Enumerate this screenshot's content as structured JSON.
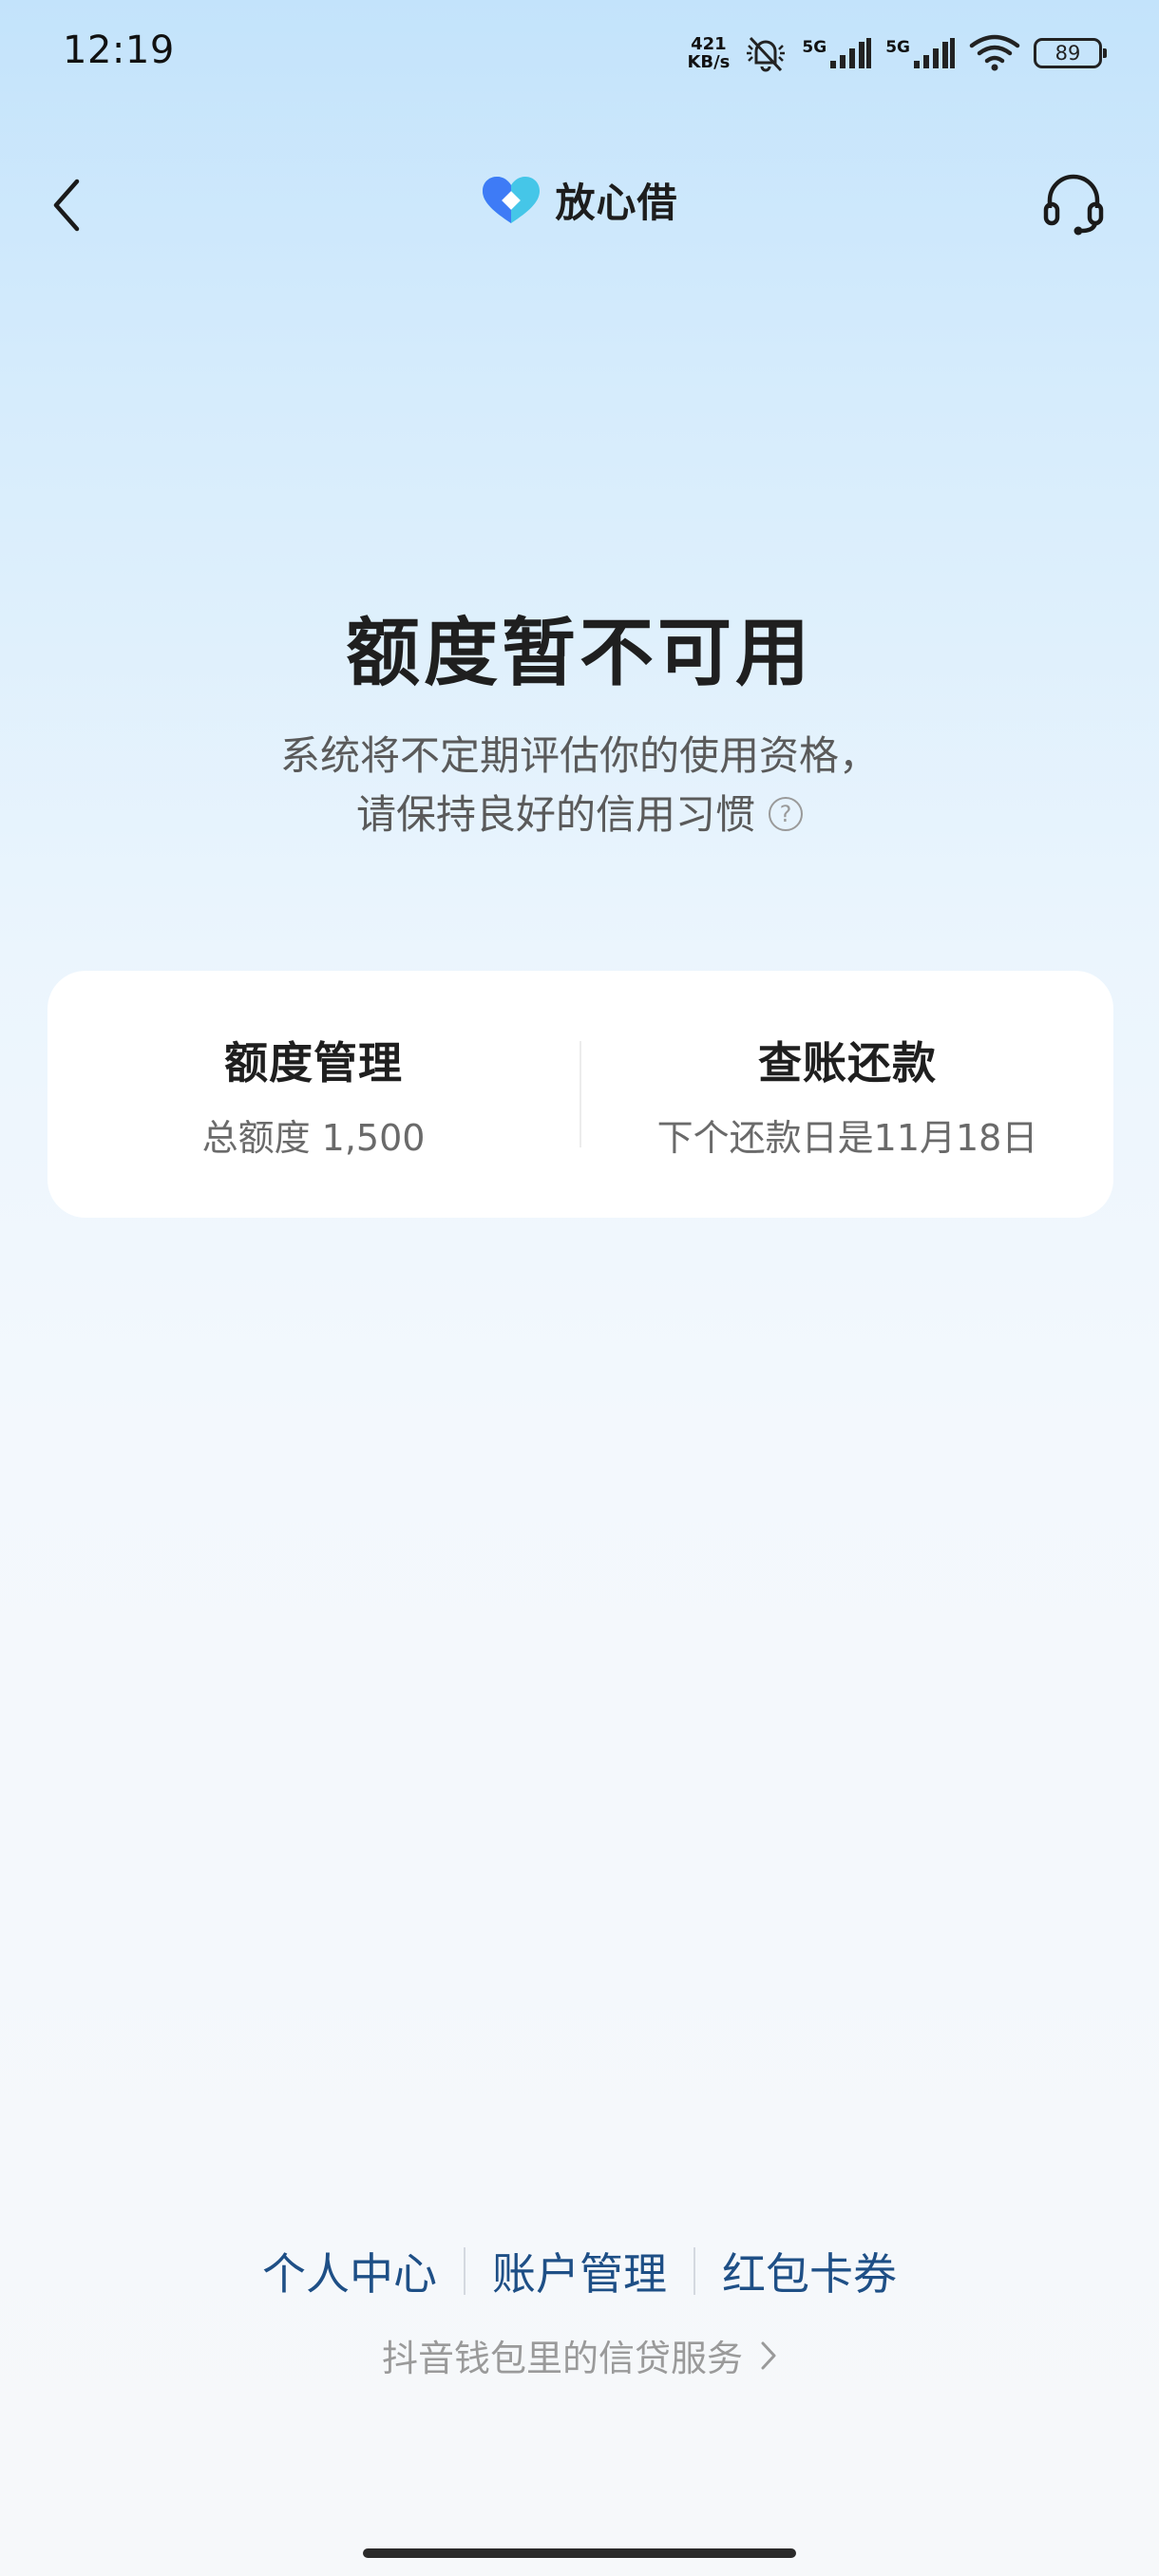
{
  "status_bar": {
    "time": "12:19",
    "net_speed_value": "421",
    "net_speed_unit": "KB/s",
    "sim1_label": "5G",
    "sim2_label": "5G",
    "battery": "89"
  },
  "header": {
    "brand_name": "放心借",
    "brand_colors": {
      "primary": "#3e7bf6",
      "secondary": "#45c6e8"
    }
  },
  "hero": {
    "title": "额度暂不可用",
    "desc_line1": "系统将不定期评估你的使用资格，",
    "desc_line2": "请保持良好的信用习惯",
    "help_glyph": "?"
  },
  "card": {
    "left": {
      "title": "额度管理",
      "subtitle": "总额度 1,500"
    },
    "right": {
      "title": "查账还款",
      "subtitle": "下个还款日是11月18日"
    }
  },
  "footer": {
    "links": [
      "个人中心",
      "账户管理",
      "红包卡券"
    ],
    "note": "抖音钱包里的信贷服务"
  },
  "icons": {
    "back": "chevron-left-icon",
    "service": "headset-icon",
    "note_arrow": "chevron-right-icon"
  },
  "colors": {
    "link": "#1e4f86",
    "title": "#1f1f1f",
    "muted": "#9a9a9a"
  }
}
